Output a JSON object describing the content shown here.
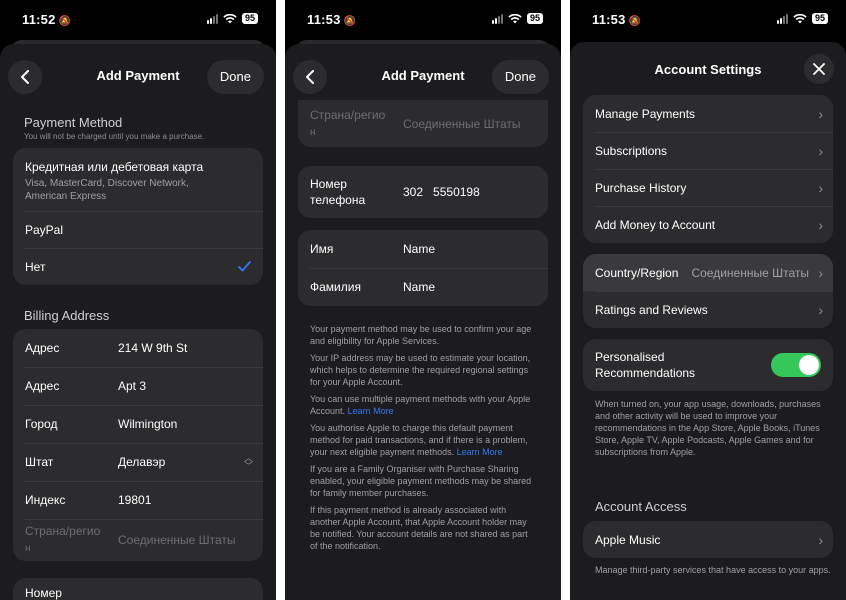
{
  "screen1": {
    "time": "11:52",
    "battery": "95",
    "nav": {
      "title": "Add Payment",
      "done": "Done"
    },
    "payment_method": {
      "title": "Payment Method",
      "subtitle": "You will not be charged until you make a purchase.",
      "card_title": "Кредитная или дебетовая карта",
      "card_sub1": "Visa, MasterCard, Discover Network,",
      "card_sub2": "American Express",
      "paypal": "PayPal",
      "none": "Нет"
    },
    "billing": {
      "title": "Billing Address",
      "rows": [
        {
          "label": "Адрес",
          "value": "214 W 9th St"
        },
        {
          "label": "Адрес",
          "value": "Apt 3"
        },
        {
          "label": "Город",
          "value": "Wilmington"
        },
        {
          "label": "Штат",
          "value": "Делавэр"
        },
        {
          "label": "Индекс",
          "value": "19801"
        }
      ],
      "country_label_1": "Страна/регио",
      "country_label_2": "н",
      "country_value": "Соединенные Штаты",
      "phone_partial": "Номер"
    }
  },
  "screen2": {
    "time": "11:53",
    "battery": "95",
    "nav": {
      "title": "Add Payment",
      "done": "Done"
    },
    "country_label_1": "Страна/регио",
    "country_label_2": "н",
    "country_value": "Соединенные Штаты",
    "phone_label_1": "Номер",
    "phone_label_2": "телефона",
    "phone_code": "302",
    "phone_number": "5550198",
    "first_name_label": "Имя",
    "first_name_value": "Name",
    "last_name_label": "Фамилия",
    "last_name_value": "Name",
    "info": {
      "p1": "Your payment method may be used to confirm your age and eligibility for Apple Services.",
      "p2": "Your IP address may be used to estimate your location, which helps to determine the required regional settings for your Apple Account.",
      "p3": "You can use multiple payment methods with your Apple Account.",
      "p4": "You authorise Apple to charge this default payment method for paid transactions, and if there is a problem, your next eligible payment methods.",
      "p5": "If you are a Family Organiser with Purchase Sharing enabled, your eligible payment methods may be shared for family member purchases.",
      "p6": "If this payment method is already associated with another Apple Account, that Apple Account holder may be notified. Your account details are not shared as part of the notification.",
      "learn_more": "Learn More"
    }
  },
  "screen3": {
    "time": "11:53",
    "battery": "95",
    "nav": {
      "title": "Account Settings"
    },
    "group1": [
      "Manage Payments",
      "Subscriptions",
      "Purchase History",
      "Add Money to Account"
    ],
    "country_label": "Country/Region",
    "country_value": "Соединенные Штаты",
    "ratings": "Ratings and Reviews",
    "personalised_1": "Personalised",
    "personalised_2": "Recommendations",
    "personalised_note": "When turned on, your app usage, downloads, purchases and other activity will be used to improve your recommendations in the App Store, Apple Books, iTunes Store, Apple TV, Apple Podcasts, Apple Games and for subscriptions from Apple.",
    "account_access": "Account Access",
    "apple_music": "Apple Music",
    "access_note": "Manage third-party services that have access to your apps."
  },
  "icons": {
    "back": "chevron-left-icon",
    "close": "close-icon",
    "check": "checkmark-icon",
    "chevron": "chevron-right-icon"
  },
  "colors": {
    "accent": "#3478f6",
    "toggle_on": "#34c759",
    "sheet": "#1c1c1e",
    "cell": "#2c2c2e"
  }
}
